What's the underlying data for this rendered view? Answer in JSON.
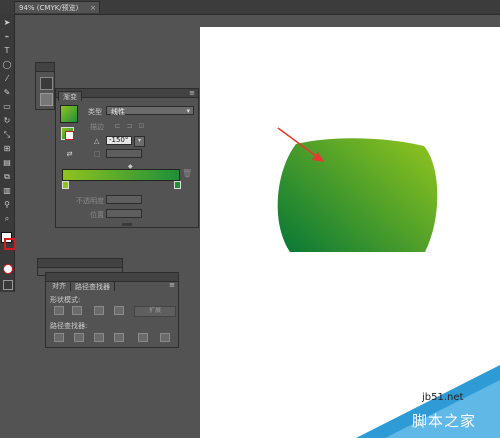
{
  "document_tab": {
    "title": "94% (CMYK/预览)",
    "close": "×"
  },
  "gradient_panel": {
    "tab": "渐变",
    "type_label": "类型",
    "type_value": "线性",
    "stroke_label": "描边",
    "angle_value": "-150°",
    "opacity_label": "不透明度",
    "position_label": "位置",
    "gradient_start_color": "#8fc31f",
    "gradient_end_color": "#1f8f3a"
  },
  "pathfinder_panel": {
    "tabs": [
      "对齐",
      "路径查找器"
    ],
    "shape_modes_label": "形状模式:",
    "pathfinders_label": "路径查找器:",
    "expand_label": "扩展"
  },
  "artwork": {
    "shape_fill_start": "#8dc21f",
    "shape_fill_end": "#0d7a36",
    "arrow_color": "#e8382f"
  },
  "watermark": {
    "site": "jb51.net",
    "name": "脚本之家"
  },
  "icons": [
    "selection-tool-icon",
    "direct-select-icon",
    "pen-tool-icon",
    "type-tool-icon",
    "ellipse-tool-icon",
    "brush-tool-icon",
    "pencil-tool-icon",
    "eraser-tool-icon",
    "rotate-tool-icon",
    "scale-tool-icon",
    "gradient-tool-icon",
    "eyedropper-tool-icon",
    "zoom-tool-icon"
  ]
}
